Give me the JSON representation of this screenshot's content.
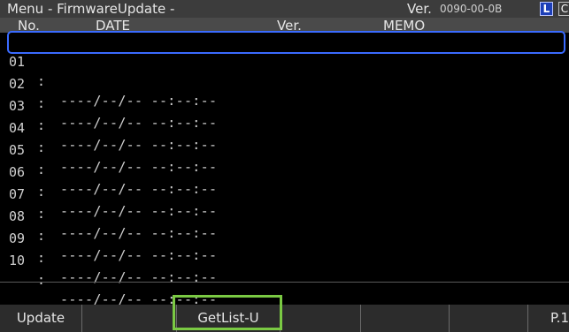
{
  "header": {
    "title": "Menu - FirmwareUpdate -",
    "version_label": "Ver.",
    "version_value": "0090-00-0B",
    "badge_l": "L",
    "badge_c": "C"
  },
  "columns": {
    "no": "No.",
    "date": "DATE",
    "ver": "Ver.",
    "memo": "MEMO"
  },
  "rows": [
    {
      "num": "01",
      "sep": ":",
      "datetime": "----/--/-- --:--:--"
    },
    {
      "num": "02",
      "sep": ":",
      "datetime": "----/--/-- --:--:--"
    },
    {
      "num": "03",
      "sep": ":",
      "datetime": "----/--/-- --:--:--"
    },
    {
      "num": "04",
      "sep": ":",
      "datetime": "----/--/-- --:--:--"
    },
    {
      "num": "05",
      "sep": ":",
      "datetime": "----/--/-- --:--:--"
    },
    {
      "num": "06",
      "sep": ":",
      "datetime": "----/--/-- --:--:--"
    },
    {
      "num": "07",
      "sep": ":",
      "datetime": "----/--/-- --:--:--"
    },
    {
      "num": "08",
      "sep": ":",
      "datetime": "----/--/-- --:--:--"
    },
    {
      "num": "09",
      "sep": ":",
      "datetime": "----/--/-- --:--:--"
    },
    {
      "num": "10",
      "sep": ":",
      "datetime": "----/--/-- --:--:--"
    }
  ],
  "fkeys": {
    "f1": "Update",
    "f2": "",
    "f3": "GetList-U",
    "f4": "",
    "f5": "",
    "f6": "",
    "f7": "P.1"
  },
  "colors": {
    "selection": "#3a6bff",
    "highlight": "#7ac943",
    "badge_l_bg": "#1d3fb8"
  }
}
